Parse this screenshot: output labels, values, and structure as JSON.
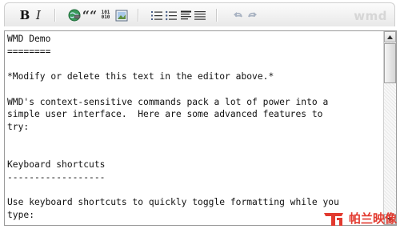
{
  "toolbar": {
    "bold_label": "B",
    "italic_label": "I",
    "quote_label": "““",
    "code_line1": "101",
    "code_line2": "010",
    "brand_label": "wmd",
    "icons": [
      "link-icon",
      "quote-icon",
      "code-icon",
      "image-icon",
      "numbered-list-icon",
      "bulleted-list-icon",
      "heading-icon",
      "horizontal-rule-icon",
      "undo-icon",
      "redo-icon"
    ]
  },
  "editor": {
    "lines": [
      "WMD Demo",
      "========",
      "",
      "*Modify or delete this text in the editor above.*",
      "",
      "WMD's context-sensitive commands pack a lot of power into a",
      "simple user interface.  Here are some advanced features to",
      "try:",
      "",
      "",
      "Keyboard shortcuts",
      "------------------",
      "",
      "Use keyboard shortcuts to quickly toggle formatting while you",
      "type:"
    ]
  },
  "watermark": {
    "logo_text": "司",
    "text": "帕兰映像"
  },
  "colors": {
    "accent_link": "#2e8b57",
    "watermark": "#e23a2f",
    "brand": "#d6d6d6"
  }
}
